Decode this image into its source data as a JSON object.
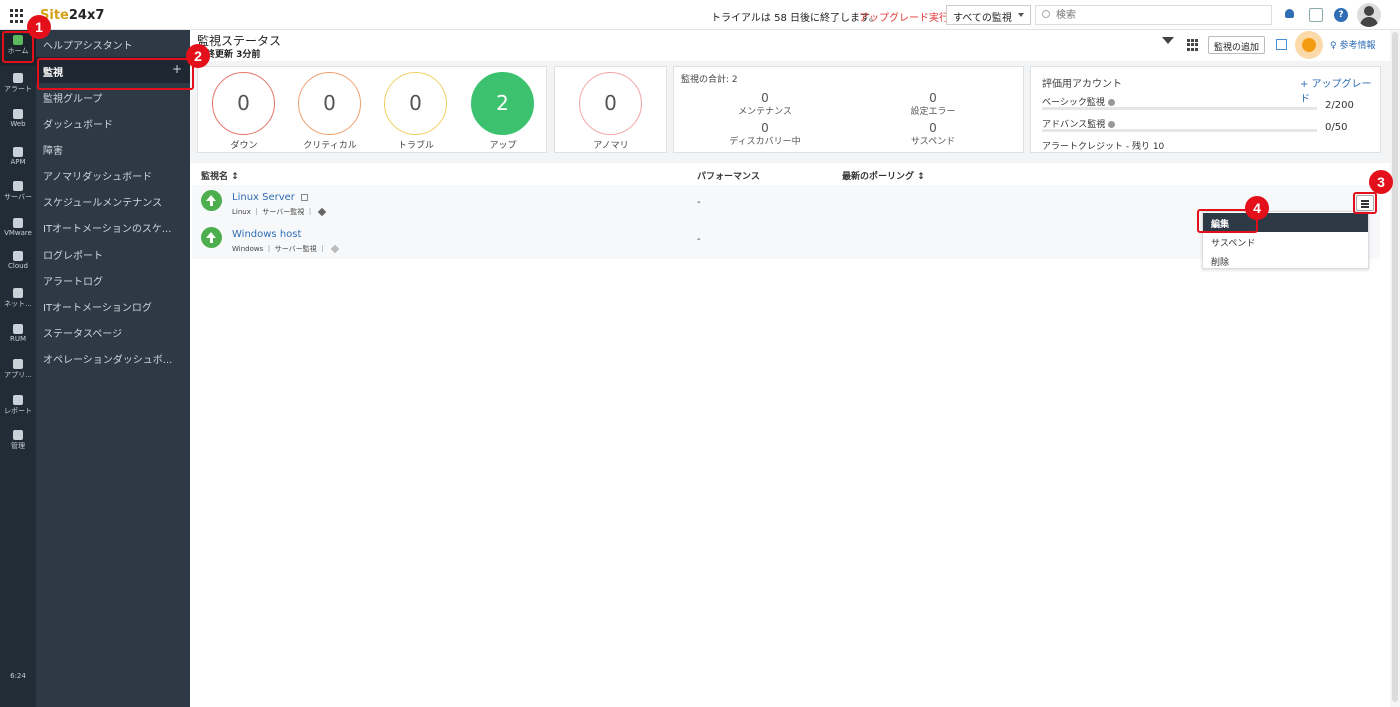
{
  "topbar": {
    "logo_prefix": "Site",
    "logo_suffix": "24x7",
    "trial_text": "トライアルは 58 日後に終了します。",
    "upgrade_text": "アップグレード実行",
    "monitor_filter": "すべての監視",
    "search_placeholder": "検索"
  },
  "rail": {
    "items": [
      {
        "label": "ホーム",
        "icon": "home-icon"
      },
      {
        "label": "アラート",
        "icon": "bell-icon"
      },
      {
        "label": "Web",
        "icon": "globe-icon"
      },
      {
        "label": "APM",
        "icon": "apm-icon"
      },
      {
        "label": "サーバー",
        "icon": "server-icon"
      },
      {
        "label": "VMware",
        "icon": "vmware-icon"
      },
      {
        "label": "Cloud",
        "icon": "cloud-icon"
      },
      {
        "label": "ネット...",
        "icon": "network-icon"
      },
      {
        "label": "RUM",
        "icon": "rum-icon"
      },
      {
        "label": "アプリ...",
        "icon": "app-icon"
      },
      {
        "label": "レポート",
        "icon": "report-icon"
      },
      {
        "label": "管理",
        "icon": "gear-icon"
      }
    ],
    "time": "6:24"
  },
  "sidebar": {
    "items": [
      {
        "label": "ヘルプアシスタント"
      },
      {
        "label": "監視"
      },
      {
        "label": "監視グループ"
      },
      {
        "label": "ダッシュボード"
      },
      {
        "label": "障害"
      },
      {
        "label": "アノマリダッシュボード"
      },
      {
        "label": "スケジュールメンテナンス"
      },
      {
        "label": "ITオートメーションのスケ..."
      },
      {
        "label": "ログレポート"
      },
      {
        "label": "アラートログ"
      },
      {
        "label": "ITオートメーションログ"
      },
      {
        "label": "ステータスページ"
      },
      {
        "label": "オペレーションダッシュボ..."
      }
    ],
    "plus": "+"
  },
  "callouts": [
    "1",
    "2",
    "3",
    "4"
  ],
  "header": {
    "title": "監視ステータス",
    "last_update": "最終更新 3分前",
    "add_monitor": "監視の追加",
    "reference": "参考情報"
  },
  "status": [
    {
      "value": "0",
      "label": "ダウン",
      "color": "#e57368"
    },
    {
      "value": "0",
      "label": "クリティカル",
      "color": "#f0a070"
    },
    {
      "value": "0",
      "label": "トラブル",
      "color": "#f1d060"
    },
    {
      "value": "2",
      "label": "アップ",
      "color": "#3cc26e"
    }
  ],
  "anomaly": {
    "value": "0",
    "label": "アノマリ",
    "color": "#f4a6a6"
  },
  "summary": {
    "title": "監視の合計: 2",
    "cells": [
      {
        "value": "0",
        "label": "メンテナンス"
      },
      {
        "value": "0",
        "label": "設定エラー"
      },
      {
        "value": "0",
        "label": "ディスカバリー中"
      },
      {
        "value": "0",
        "label": "サスペンド"
      }
    ]
  },
  "evaluation": {
    "title": "評価用アカウント",
    "upgrade": "+ アップグレード",
    "basic_label": "ベーシック監視",
    "basic_value": "2/200",
    "advanced_label": "アドバンス監視",
    "advanced_value": "0/50",
    "credit": "アラートクレジット - 残り 10"
  },
  "table": {
    "headers": {
      "name": "監視名 ↕",
      "performance": "パフォーマンス",
      "last_poll": "最新のポーリング ↕"
    },
    "rows": [
      {
        "name": "Linux Server",
        "meta": "Linux ｜ サーバー監視 ｜",
        "performance": "-"
      },
      {
        "name": "Windows host",
        "meta": "Windows ｜ サーバー監視 ｜",
        "performance": "-"
      }
    ]
  },
  "dropdown": {
    "items": [
      {
        "label": "編集"
      },
      {
        "label": "サスペンド"
      },
      {
        "label": "削除"
      }
    ]
  }
}
